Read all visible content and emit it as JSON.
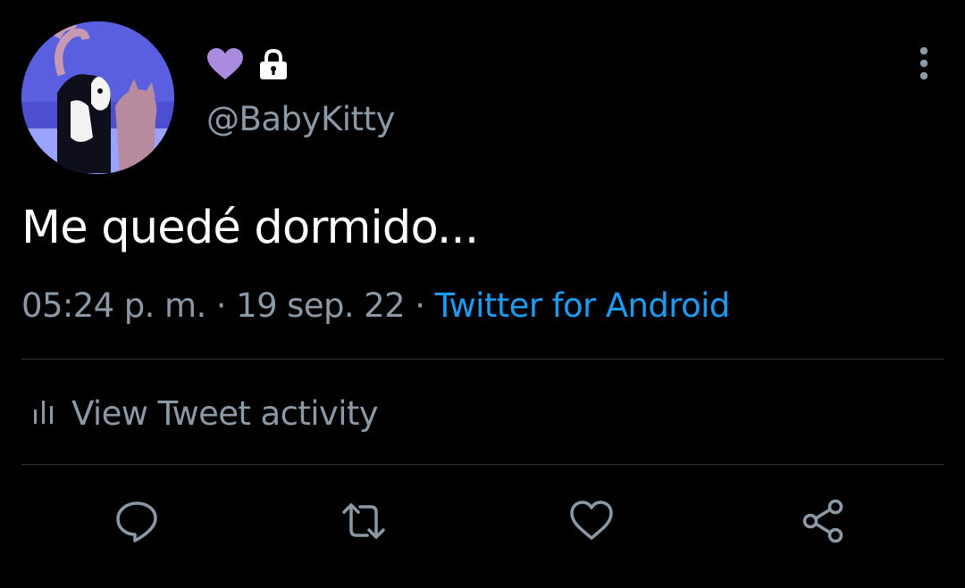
{
  "user": {
    "handle": "@BabyKitty",
    "name_emoji": "purple-heart",
    "protected": true
  },
  "tweet": {
    "text": "Me quedé dormido...",
    "time": "05:24 p. m.",
    "separator": "·",
    "date": "19 sep. 22",
    "source": "Twitter for Android"
  },
  "activity": {
    "label": "View Tweet activity"
  },
  "actions": [
    "reply-icon",
    "retweet-icon",
    "like-icon",
    "share-icon"
  ],
  "colors": {
    "background": "#000000",
    "text": "#ffffff",
    "secondary_text": "#8b98a5",
    "link": "#1d9bf0",
    "divider": "#2f3336",
    "heart": "#a98be0"
  }
}
